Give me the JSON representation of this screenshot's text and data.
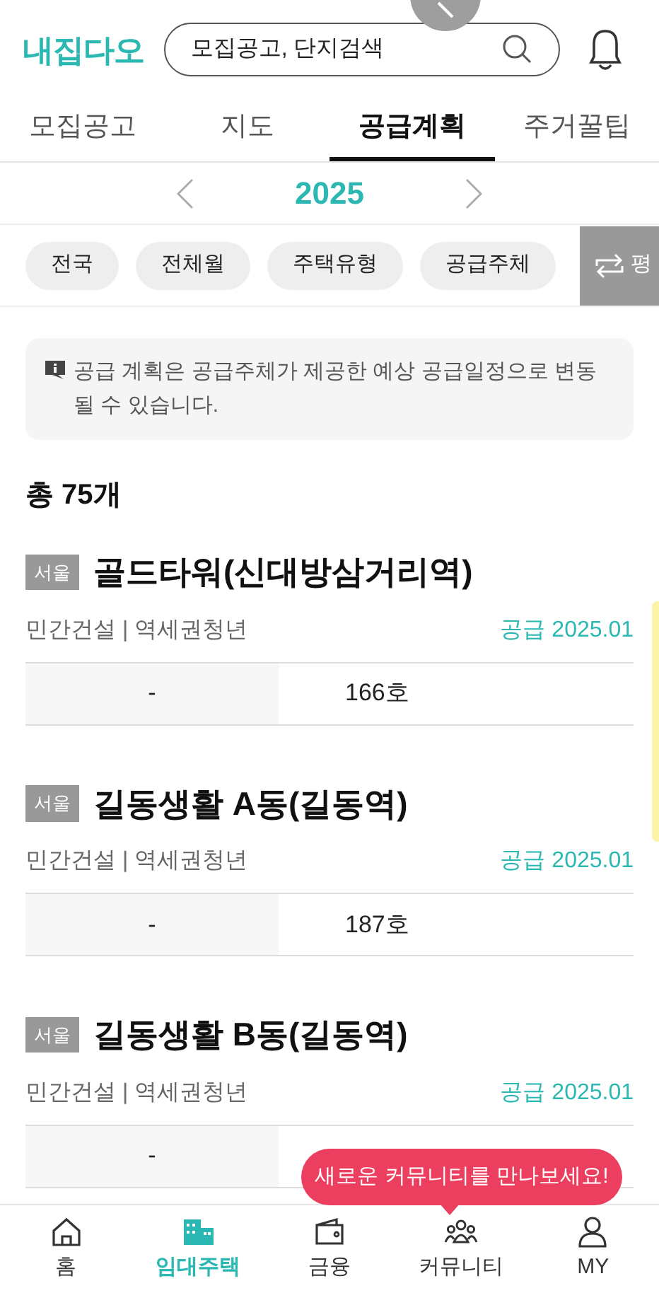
{
  "header": {
    "logo": "내집다오",
    "search": {
      "placeholder": "모집공고, 단지검색"
    }
  },
  "tabs": [
    {
      "label": "모집공고",
      "selected": false
    },
    {
      "label": "지도",
      "selected": false
    },
    {
      "label": "공급계획",
      "selected": true
    },
    {
      "label": "주거꿀팁",
      "selected": false
    }
  ],
  "year": "2025",
  "filters": [
    "전국",
    "전체월",
    "주택유형",
    "공급주체"
  ],
  "toggle": {
    "label": "평"
  },
  "notice": "공급 계획은 공급주체가 제공한 예상 공급일정으로 변동될 수 있습니다.",
  "total": "총 75개",
  "items": [
    {
      "region": "서울",
      "title": "골드타워(신대방삼거리역)",
      "category": "민간건설 | 역세권청년",
      "supply": "공급 2025.01",
      "col_1": "-",
      "col_2": "166호"
    },
    {
      "region": "서울",
      "title": "길동생활 A동(길동역)",
      "category": "민간건설 | 역세권청년",
      "supply": "공급 2025.01",
      "col_1": "-",
      "col_2": "187호"
    },
    {
      "region": "서울",
      "title": "길동생활 B동(길동역)",
      "category": "민간건설 | 역세권청년",
      "supply": "공급 2025.01",
      "col_1": "-"
    }
  ],
  "tooltip": "새로운 커뮤니티를 만나보세요!",
  "nav": [
    {
      "label": "홈",
      "kind": "home",
      "selected": false
    },
    {
      "label": "임대주택",
      "kind": "building",
      "selected": true
    },
    {
      "label": "금융",
      "kind": "wallet",
      "selected": false
    },
    {
      "label": "커뮤니티",
      "kind": "people",
      "selected": false
    },
    {
      "label": "MY",
      "kind": "person",
      "selected": false
    }
  ]
}
